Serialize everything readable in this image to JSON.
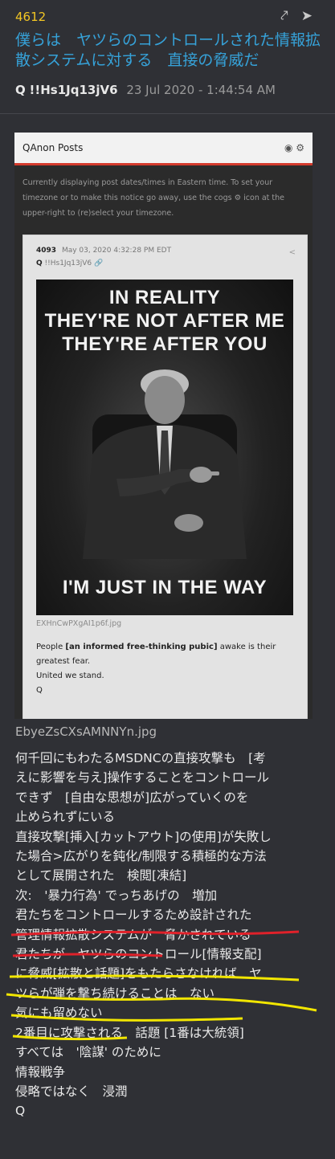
{
  "post": {
    "number": "4612",
    "title": "僕らは　ヤツらのコントロールされた情報拡散システムに対する　直接の脅威だ",
    "author": "Q",
    "tripcode": "!!Hs1Jq13jV6",
    "timestamp": "23 Jul 2020 - 1:44:54 AM",
    "image_filename": "EbyeZsCXsAMNNYn.jpg"
  },
  "embedded": {
    "header_title": "QAnon Posts",
    "notice": "Currently displaying post dates/times in Eastern time. To set your timezone or to make this notice go away, use the cogs ⚙ icon at the upper-right to (re)select your timezone.",
    "card": {
      "post_number": "4093",
      "date": "May 03, 2020 4:32:28 PM EDT",
      "author": "Q",
      "tripcode": "!!Hs1Jq13jV6",
      "poster_top_1": "IN REALITY",
      "poster_top_2": "THEY'RE NOT AFTER ME",
      "poster_top_3": "THEY'RE AFTER YOU",
      "poster_bottom": "I'M JUST IN THE WAY",
      "filename": "EXHnCwPXgAI1p6f.jpg",
      "text_1_pre": "People ",
      "text_1_bold": "[an informed free-thinking pubic]",
      "text_1_post": " awake is their greatest fear.",
      "text_2": "United we stand.",
      "text_3": "Q"
    }
  },
  "body_lines": [
    "何千回にもわたるMSDNCの直接攻撃も　[考",
    "えに影響を与え]操作することをコントロール",
    "できず　[自由な思想が]広がっていくのを",
    "止められずにいる",
    "直接攻撃[挿入[カットアウト]の使用]が失敗し",
    "た場合>広がりを鈍化/制限する積極的な方法",
    "として展開された　検閲[凍結]",
    "次:　'暴力行為' でっちあげの　増加",
    "君たちをコントロールするため設計された",
    "管理情報拡散システムが　脅かされている",
    "君たちが　ヤツらのコントロール[情報支配]",
    "に脅威[拡散と話題]をもたらさなければ　ヤ",
    "ツらが弾を撃ち続けることは　ない",
    "気にも留めない",
    "2番目に攻撃される　話題 [1番は大統領]",
    "すべては　'陰謀' のために",
    "情報戦争",
    "侵略ではなく　浸潤",
    "Q"
  ],
  "colors": {
    "background": "#2f3035",
    "post_number": "#f3c623",
    "title": "#36a2d9",
    "red_underline": "#e0212a",
    "yellow_underline": "#f2e600"
  }
}
